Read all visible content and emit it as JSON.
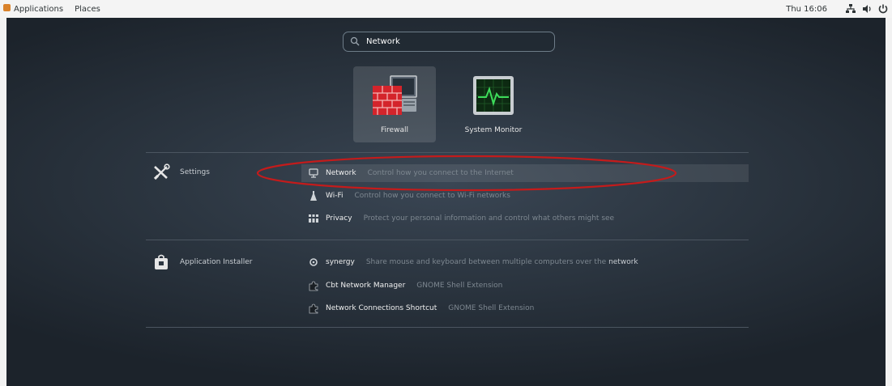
{
  "topbar": {
    "applications": "Applications",
    "places": "Places",
    "clock": "Thu 16:06"
  },
  "search": {
    "value": "Network"
  },
  "apps": [
    {
      "label": "Firewall"
    },
    {
      "label": "System Monitor"
    }
  ],
  "settings": {
    "category": "Settings",
    "items": [
      {
        "name": "Network",
        "description": "Control how you connect to the Internet"
      },
      {
        "name": "Wi-Fi",
        "description": "Control how you connect to Wi-Fi networks"
      },
      {
        "name": "Privacy",
        "description": "Protect your personal information and control what others might see"
      }
    ]
  },
  "installer": {
    "category": "Application Installer",
    "items": [
      {
        "name": "synergy",
        "description": "Share mouse and keyboard between multiple computers over the",
        "highlight": "network"
      },
      {
        "name": "Cbt Network Manager",
        "description": "GNOME Shell Extension"
      },
      {
        "name": "Network Connections Shortcut",
        "description": "GNOME Shell Extension"
      }
    ]
  },
  "colors": {
    "accent": "#2a76c6",
    "annotation": "#c41b1b",
    "firewall_red": "#d4242b",
    "monitor_green": "#2fb24a"
  }
}
